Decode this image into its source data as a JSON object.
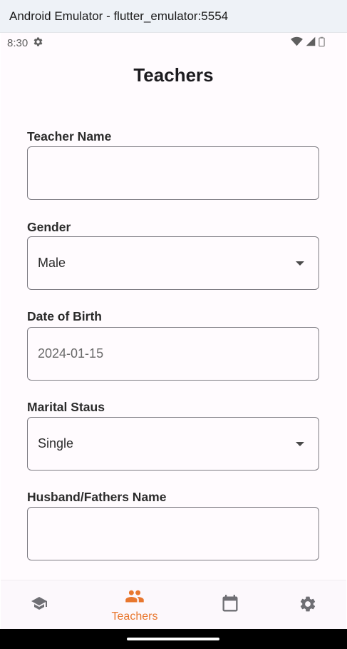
{
  "window": {
    "title": "Android Emulator - flutter_emulator:5554"
  },
  "status_bar": {
    "time": "8:30",
    "icons": [
      "settings-icon",
      "wifi-icon",
      "signal-icon",
      "battery-icon"
    ]
  },
  "app": {
    "title": "Teachers"
  },
  "form": {
    "teacher_name": {
      "label": "Teacher Name",
      "value": ""
    },
    "gender": {
      "label": "Gender",
      "value": "Male"
    },
    "dob": {
      "label": "Date of Birth",
      "value": "2024-01-15"
    },
    "marital_status": {
      "label": "Marital Staus",
      "value": "Single"
    },
    "husband_father": {
      "label": "Husband/Fathers Name",
      "value": ""
    }
  },
  "nav": {
    "items": [
      {
        "icon": "school-icon",
        "label": "",
        "active": false
      },
      {
        "icon": "people-icon",
        "label": "Teachers",
        "active": true
      },
      {
        "icon": "calendar-icon",
        "label": "",
        "active": false
      },
      {
        "icon": "settings-icon",
        "label": "",
        "active": false
      }
    ]
  },
  "colors": {
    "accent": "#e8772e",
    "inactive_icon": "#6f6f74",
    "background": "#fffbfe",
    "border": "#7d7b82"
  }
}
